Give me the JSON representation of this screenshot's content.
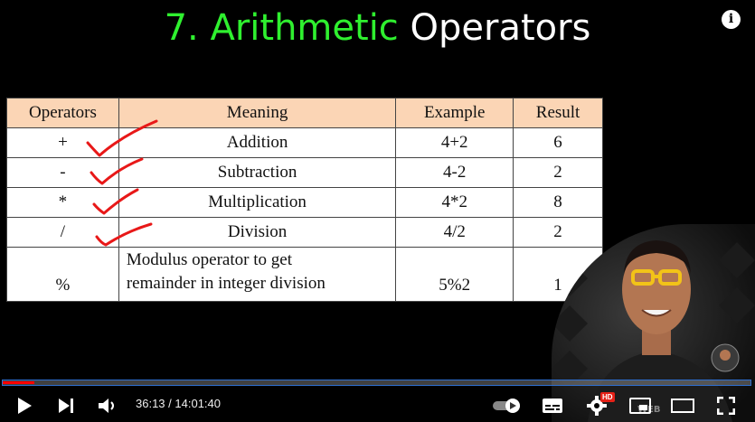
{
  "slide": {
    "title_number_word": "7. Arithmetic",
    "title_rest": "Operators"
  },
  "info_icon": "i",
  "table": {
    "headers": [
      "Operators",
      "Meaning",
      "Example",
      "Result"
    ],
    "rows": [
      {
        "operator": "+",
        "meaning": "Addition",
        "example": "4+2",
        "result": "6"
      },
      {
        "operator": "-",
        "meaning": "Subtraction",
        "example": "4-2",
        "result": "2"
      },
      {
        "operator": "*",
        "meaning": "Multiplication",
        "example": "4*2",
        "result": "8"
      },
      {
        "operator": "/",
        "meaning": "Division",
        "example": "4/2",
        "result": "2"
      },
      {
        "operator": "%",
        "meaning_line1": "Modulus operator to get",
        "meaning_line2": "remainder in integer division",
        "example": "5%2",
        "result": "1"
      }
    ]
  },
  "player": {
    "current_time": "36:13",
    "separator": " / ",
    "duration": "14:01:40",
    "progress_fraction": 0.043,
    "quality_badge": "HD",
    "icons": [
      "play-icon",
      "next-icon",
      "volume-icon",
      "autoplay-toggle-icon",
      "subtitles-icon",
      "settings-icon",
      "miniplayer-icon",
      "theater-mode-icon",
      "fullscreen-icon"
    ]
  },
  "colors": {
    "title_green": "#2ff02f",
    "header_fill": "#fbd5b5",
    "tick_red": "#e81818",
    "progress_red": "#ff0000"
  }
}
